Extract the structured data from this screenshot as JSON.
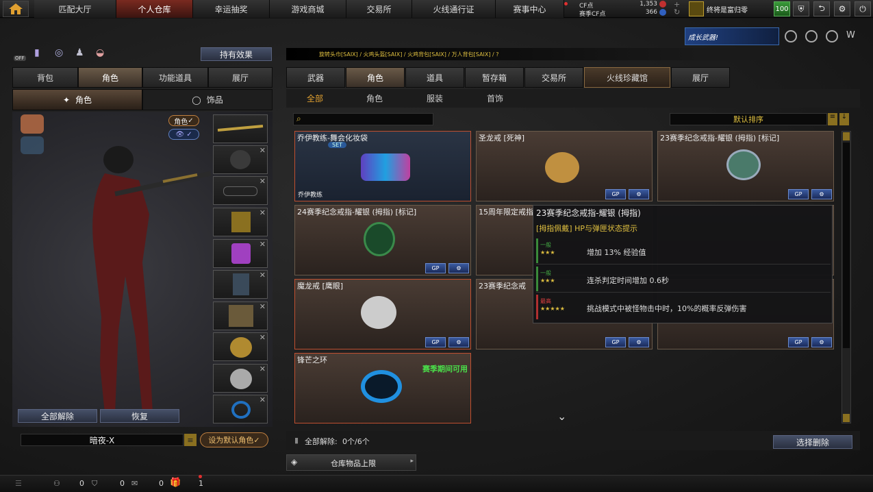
{
  "topnav": {
    "tabs": [
      "匹配大厅",
      "个人仓库",
      "幸运抽奖",
      "游戏商城",
      "交易所",
      "火线通行证",
      "赛事中心"
    ],
    "active": 1
  },
  "currency": {
    "cf_label": "CF点",
    "cf_value": "1,353",
    "season_label": "赛季CF点",
    "season_value": "366"
  },
  "user": {
    "name": "终将是富归零",
    "level": "100"
  },
  "left": {
    "effects_button": "持有效果",
    "toggle_off": "OFF",
    "tabs": [
      "背包",
      "角色",
      "功能道具",
      "展厅"
    ],
    "active_tab": 1,
    "subtabs": [
      "角色",
      "饰品"
    ],
    "role_badge": "角色",
    "buttons": {
      "clear_all": "全部解除",
      "restore": "恢复",
      "set_default": "设为默认角色"
    },
    "character_name": "暗夜-X"
  },
  "right": {
    "breadcrumb": "旋转头巾[SAIX] / 火鸡头盔[SAIX] / 火鸡背包[SAIX] / 万人背包[SAIX] / ?",
    "tabs": [
      "武器",
      "角色",
      "道具",
      "暂存箱",
      "交易所",
      "火线珍藏馆",
      "展厅"
    ],
    "active_tab": 1,
    "subtabs": [
      "全部",
      "角色",
      "服装",
      "首饰"
    ],
    "active_subtab": 0,
    "sort_label": "默认排序",
    "search_placeholder": "",
    "items": [
      {
        "title": "乔伊教练-舞会化妆袋",
        "badge": "SET",
        "footer": "乔伊教练"
      },
      {
        "title": "圣龙戒 [死神]"
      },
      {
        "title": "23赛季纪念戒指-耀银 (拇指) [标记]"
      },
      {
        "title": "24赛季纪念戒指-耀银 (拇指) [标记]"
      },
      {
        "title": "15周年限定戒指"
      },
      {
        "title": ""
      },
      {
        "title": "魔龙戒 [鹰眼]"
      },
      {
        "title": "23赛季纪念戒"
      },
      {
        "title": ""
      },
      {
        "title": "锋芒之环",
        "season_note": "赛季期间可用"
      }
    ],
    "option_gp": "GP",
    "footer": {
      "clear_label": "全部解除:",
      "clear_count": "0个/6个",
      "batch_delete": "选择删除",
      "capacity": "仓库物品上限"
    }
  },
  "tooltip": {
    "title": "23赛季纪念戒指-耀银 (拇指)",
    "subtitle": "[拇指佩戴] HP与弹匣状态提示",
    "rows": [
      {
        "grade": "一般",
        "stars": "★★★",
        "text": "增加 13% 经验值",
        "color": "#3a8a3a"
      },
      {
        "grade": "一般",
        "stars": "★★★",
        "text": "连杀判定时间增加 0.6秒",
        "color": "#3a8a3a"
      },
      {
        "grade": "最高",
        "stars": "★★★★★",
        "text": "挑战模式中被怪物击中时，10%的概率反弹伤害",
        "color": "#b03030"
      }
    ]
  },
  "statusbar": {
    "counts": [
      "0",
      "0",
      "0",
      "1"
    ]
  },
  "banner": {
    "text": "成长武器!"
  }
}
